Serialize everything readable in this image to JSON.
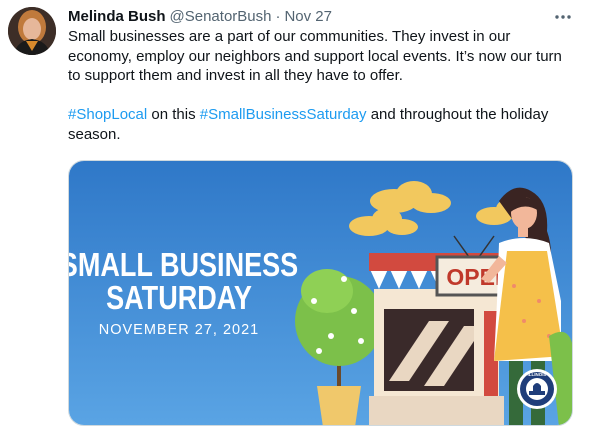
{
  "tweet": {
    "display_name": "Melinda Bush",
    "handle": "@SenatorBush",
    "separator": "·",
    "timestamp": "Nov 27",
    "more_icon": "more-horizontal-icon",
    "paragraph1": "Small businesses are a part of our communities. They invest in our economy, employ our neighbors and support local events. It’s now our turn to support them and invest in all they have to offer.",
    "paragraph2": {
      "hashtag1": "#ShopLocal",
      "text1": " on this ",
      "hashtag2": "#SmallBusinessSaturday",
      "text2": " and throughout the holiday season."
    }
  },
  "image": {
    "title_line1": "SMALL BUSINESS",
    "title_line2": "SATURDAY",
    "date": "NOVEMBER 27, 2021",
    "sign": "OPEN",
    "seal_text": "ILLINOIS"
  },
  "colors": {
    "link": "#1d9bf0",
    "text": "#0f1419",
    "secondary": "#536471",
    "image_bg": "#3f86d0"
  }
}
